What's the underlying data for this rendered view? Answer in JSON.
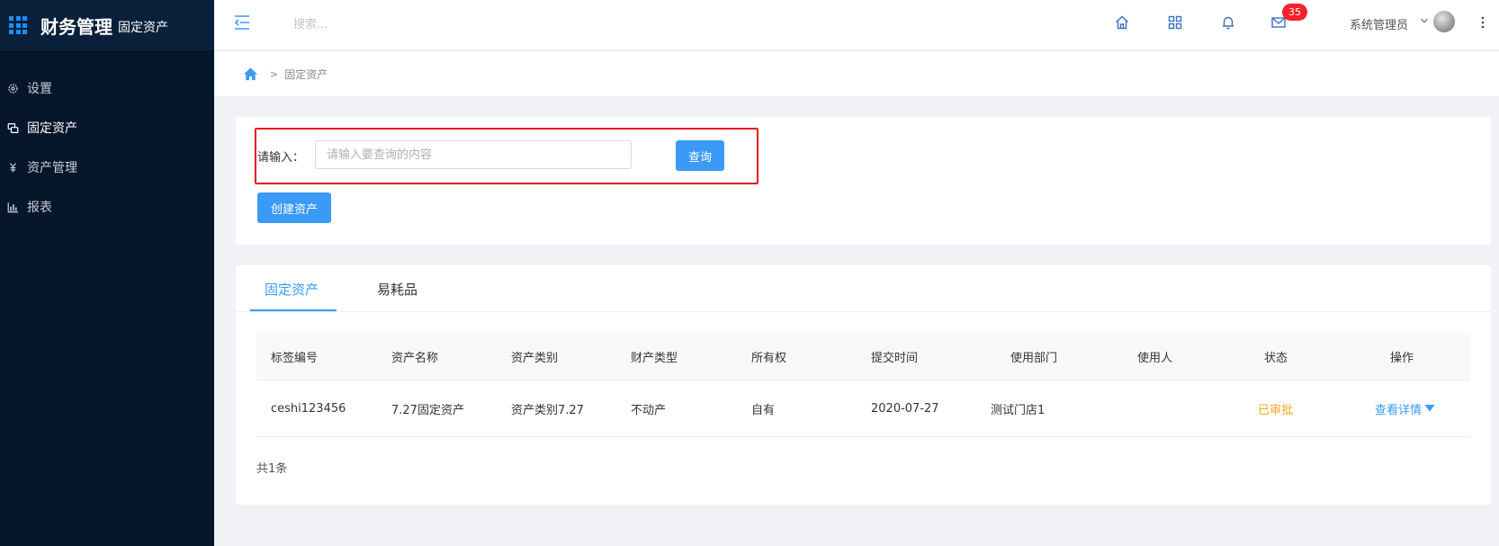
{
  "sidebar": {
    "brand_title": "财务管理",
    "brand_sub": "固定资产",
    "items": [
      {
        "label": "设置",
        "icon": "gear-icon"
      },
      {
        "label": "固定资产",
        "icon": "asset-icon"
      },
      {
        "label": "资产管理",
        "icon": "money-icon"
      },
      {
        "label": "报表",
        "icon": "bar-chart-icon"
      }
    ]
  },
  "header": {
    "search_placeholder": "搜索...",
    "mail_badge": "35",
    "user_name": "系统管理员"
  },
  "breadcrumb": {
    "separator": ">",
    "current": "固定资产"
  },
  "search_panel": {
    "label": "请输入：",
    "input_placeholder": "请输入要查询的内容",
    "query_button": "查询",
    "create_button": "创建资产"
  },
  "tabs": [
    {
      "label": "固定资产",
      "active": true
    },
    {
      "label": "易耗品",
      "active": false
    }
  ],
  "table": {
    "columns": [
      "标签编号",
      "资产名称",
      "资产类别",
      "财产类型",
      "所有权",
      "提交时间",
      "使用部门",
      "使用人",
      "状态",
      "操作"
    ],
    "rows": [
      {
        "tag_no": "ceshi123456",
        "name": "7.27固定资产",
        "category": "资产类别7.27",
        "property_type": "不动产",
        "ownership": "自有",
        "submit_time": "2020-07-27",
        "department": "测试门店1",
        "user": "",
        "status": "已审批",
        "action": "查看详情"
      }
    ],
    "total": "共1条"
  },
  "colors": {
    "sidebar_bg": "#06162b",
    "accent": "#3a9af5",
    "status_approved": "#f5a623",
    "badge": "#f5222d",
    "highlight_box": "#e51c23"
  }
}
